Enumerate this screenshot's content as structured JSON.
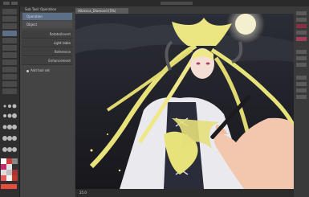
{
  "subtool": {
    "header": "Sub Tool: Operation",
    "items": [
      "Operation",
      "Object"
    ],
    "properties": [
      "Rotate/Invert",
      "Light table",
      "Reference",
      "Enhancement"
    ],
    "pin_label": "Add tool set"
  },
  "document": {
    "tab_title": "Hibiscus_Diamond (5%)"
  },
  "statusbar": {
    "zoom": "25.0"
  },
  "colors": {
    "accent": "#5c6f86",
    "hair": "#e8e27a",
    "moon": "#f4efcf",
    "skin": "#f3c7ad"
  },
  "icons": [
    "pen-tool-icon",
    "pin-icon",
    "moon-icon"
  ]
}
